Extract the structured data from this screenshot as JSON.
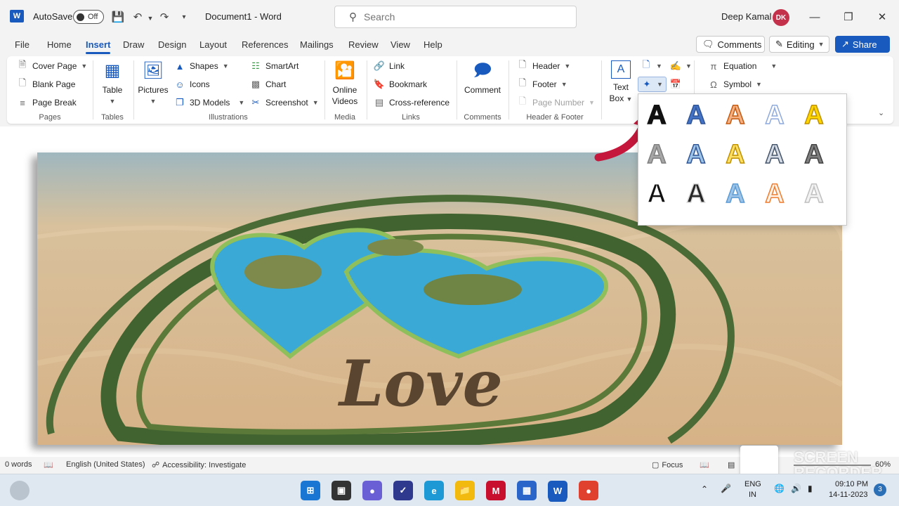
{
  "titlebar": {
    "autosave_label": "AutoSave",
    "autosave_state": "Off",
    "document_title": "Document1  -  Word",
    "search_placeholder": "Search",
    "user_name": "Deep Kamal",
    "user_initials": "DK"
  },
  "menu": {
    "tabs": [
      "File",
      "Home",
      "Insert",
      "Draw",
      "Design",
      "Layout",
      "References",
      "Mailings",
      "Review",
      "View",
      "Help"
    ],
    "active_tab": "Insert",
    "comments_label": "Comments",
    "editing_label": "Editing",
    "share_label": "Share"
  },
  "ribbon": {
    "pages": {
      "cover_page": "Cover Page",
      "blank_page": "Blank Page",
      "page_break": "Page Break",
      "group": "Pages"
    },
    "tables": {
      "table": "Table",
      "group": "Tables"
    },
    "illustrations": {
      "pictures": "Pictures",
      "shapes": "Shapes",
      "icons": "Icons",
      "models": "3D Models",
      "smartart": "SmartArt",
      "chart": "Chart",
      "screenshot": "Screenshot",
      "group": "Illustrations"
    },
    "media": {
      "online_videos_1": "Online",
      "online_videos_2": "Videos",
      "group": "Media"
    },
    "links": {
      "link": "Link",
      "bookmark": "Bookmark",
      "cross_reference": "Cross-reference",
      "group": "Links"
    },
    "comments": {
      "comment": "Comment",
      "group": "Comments"
    },
    "header_footer": {
      "header": "Header",
      "footer": "Footer",
      "page_number": "Page Number",
      "group": "Header & Footer"
    },
    "text": {
      "text_box_1": "Text",
      "text_box_2": "Box"
    },
    "symbols": {
      "equation": "Equation",
      "symbol": "Symbol"
    }
  },
  "wordart": {
    "glyph": "A",
    "styles": [
      {
        "fill": "#111111",
        "stroke": "#111111"
      },
      {
        "fill": "#4472c4",
        "stroke": "#2f5597"
      },
      {
        "fill": "#f4b183",
        "stroke": "#c55a11"
      },
      {
        "fill": "#ffffff",
        "stroke": "#8faadc"
      },
      {
        "fill": "#ffd700",
        "stroke": "#bf9000"
      },
      {
        "fill": "#a6a6a6",
        "stroke": "#7f7f7f"
      },
      {
        "fill": "#9dc3e6",
        "stroke": "#2f5597"
      },
      {
        "fill": "#ffe066",
        "stroke": "#bf9000"
      },
      {
        "fill": "#d6dce5",
        "stroke": "#44546a"
      },
      {
        "fill": "#7f7f7f",
        "stroke": "#404040"
      },
      {
        "fill": "#111111",
        "stroke": "#ffffff"
      },
      {
        "fill": "#262626",
        "stroke": "#d9d9d9"
      },
      {
        "fill": "#9dc3e6",
        "stroke": "#5b9bd5"
      },
      {
        "fill": "#fff2e6",
        "stroke": "#ed7d31"
      },
      {
        "fill": "#f2f2f2",
        "stroke": "#bfbfbf"
      }
    ]
  },
  "document": {
    "image_text": "Love"
  },
  "statusbar": {
    "words": "0 words",
    "language": "English (United States)",
    "accessibility": "Accessibility: Investigate",
    "focus": "Focus",
    "zoom": "60%"
  },
  "watermark": {
    "line1": "SCREEN",
    "line2": "RECORDER"
  },
  "taskbar": {
    "lang_1": "ENG",
    "lang_2": "IN",
    "time": "09:10 PM",
    "date": "14-11-2023",
    "notifications": "3"
  },
  "colors": {
    "accent": "#185abd",
    "heart_water": "#3aa9d6",
    "vegetation": "#3f6b2f"
  }
}
